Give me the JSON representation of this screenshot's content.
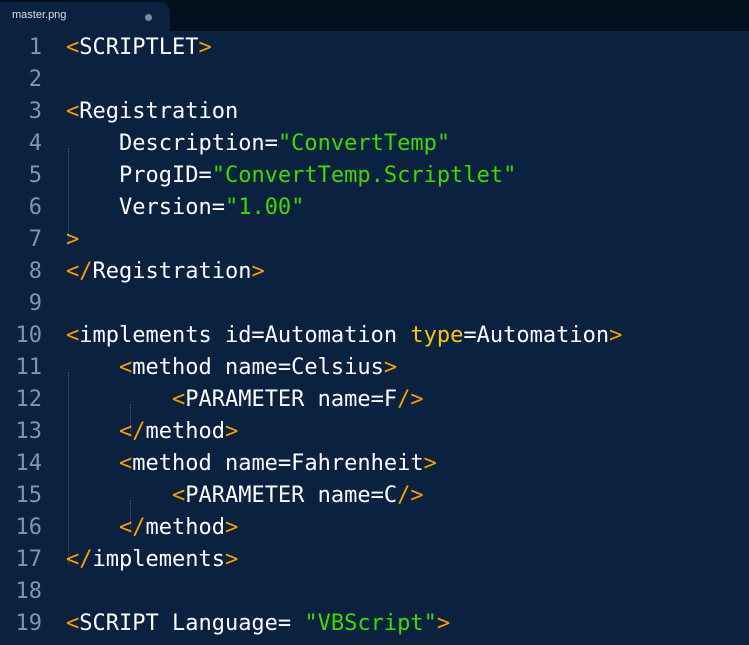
{
  "tab": {
    "title": "master.png"
  },
  "lines": [
    {
      "number": "1",
      "indent": "",
      "segments": [
        {
          "t": "<",
          "c": "punct"
        },
        {
          "t": "SCRIPTLET",
          "c": ""
        },
        {
          "t": ">",
          "c": "punct"
        }
      ]
    },
    {
      "number": "2",
      "indent": "",
      "segments": []
    },
    {
      "number": "3",
      "indent": "",
      "segments": [
        {
          "t": "<",
          "c": "punct"
        },
        {
          "t": "Registration",
          "c": ""
        }
      ]
    },
    {
      "number": "4",
      "indent": "    ",
      "segments": [
        {
          "t": "Description=",
          "c": ""
        },
        {
          "t": "\"ConvertTemp\"",
          "c": "str"
        }
      ]
    },
    {
      "number": "5",
      "indent": "    ",
      "segments": [
        {
          "t": "ProgID=",
          "c": ""
        },
        {
          "t": "\"ConvertTemp.Scriptlet\"",
          "c": "str"
        }
      ]
    },
    {
      "number": "6",
      "indent": "    ",
      "segments": [
        {
          "t": "Version=",
          "c": ""
        },
        {
          "t": "\"1.00\"",
          "c": "str"
        }
      ]
    },
    {
      "number": "7",
      "indent": "",
      "segments": [
        {
          "t": ">",
          "c": "punct"
        }
      ]
    },
    {
      "number": "8",
      "indent": "",
      "segments": [
        {
          "t": "</",
          "c": "punct"
        },
        {
          "t": "Registration",
          "c": ""
        },
        {
          "t": ">",
          "c": "punct"
        }
      ]
    },
    {
      "number": "9",
      "indent": "",
      "segments": []
    },
    {
      "number": "10",
      "indent": "",
      "segments": [
        {
          "t": "<",
          "c": "punct"
        },
        {
          "t": "implements id=Automation ",
          "c": ""
        },
        {
          "t": "type",
          "c": "attr"
        },
        {
          "t": "=Automation",
          "c": ""
        },
        {
          "t": ">",
          "c": "punct"
        }
      ]
    },
    {
      "number": "11",
      "indent": "    ",
      "segments": [
        {
          "t": "<",
          "c": "punct"
        },
        {
          "t": "method name=Celsius",
          "c": ""
        },
        {
          "t": ">",
          "c": "punct"
        }
      ]
    },
    {
      "number": "12",
      "indent": "        ",
      "segments": [
        {
          "t": "<",
          "c": "punct"
        },
        {
          "t": "PARAMETER name=F",
          "c": ""
        },
        {
          "t": "/>",
          "c": "punct"
        }
      ]
    },
    {
      "number": "13",
      "indent": "    ",
      "segments": [
        {
          "t": "</",
          "c": "punct"
        },
        {
          "t": "method",
          "c": ""
        },
        {
          "t": ">",
          "c": "punct"
        }
      ]
    },
    {
      "number": "14",
      "indent": "    ",
      "segments": [
        {
          "t": "<",
          "c": "punct"
        },
        {
          "t": "method name=Fahrenheit",
          "c": ""
        },
        {
          "t": ">",
          "c": "punct"
        }
      ]
    },
    {
      "number": "15",
      "indent": "        ",
      "segments": [
        {
          "t": "<",
          "c": "punct"
        },
        {
          "t": "PARAMETER name=C",
          "c": ""
        },
        {
          "t": "/>",
          "c": "punct"
        }
      ]
    },
    {
      "number": "16",
      "indent": "    ",
      "segments": [
        {
          "t": "</",
          "c": "punct"
        },
        {
          "t": "method",
          "c": ""
        },
        {
          "t": ">",
          "c": "punct"
        }
      ]
    },
    {
      "number": "17",
      "indent": "",
      "segments": [
        {
          "t": "</",
          "c": "punct"
        },
        {
          "t": "implements",
          "c": ""
        },
        {
          "t": ">",
          "c": "punct"
        }
      ]
    },
    {
      "number": "18",
      "indent": "",
      "segments": []
    },
    {
      "number": "19",
      "indent": "",
      "segments": [
        {
          "t": "<",
          "c": "punct"
        },
        {
          "t": "SCRIPT Language= ",
          "c": ""
        },
        {
          "t": "\"VBScript\"",
          "c": "str"
        },
        {
          "t": ">",
          "c": "punct"
        }
      ]
    }
  ],
  "colors": {
    "background": "#0b2140",
    "tabbar": "#03111e",
    "text": "#ffffff",
    "line_number": "#8495a8",
    "punctuation": "#ff9d00",
    "string": "#3ad900",
    "keyword": "#ffc600"
  }
}
